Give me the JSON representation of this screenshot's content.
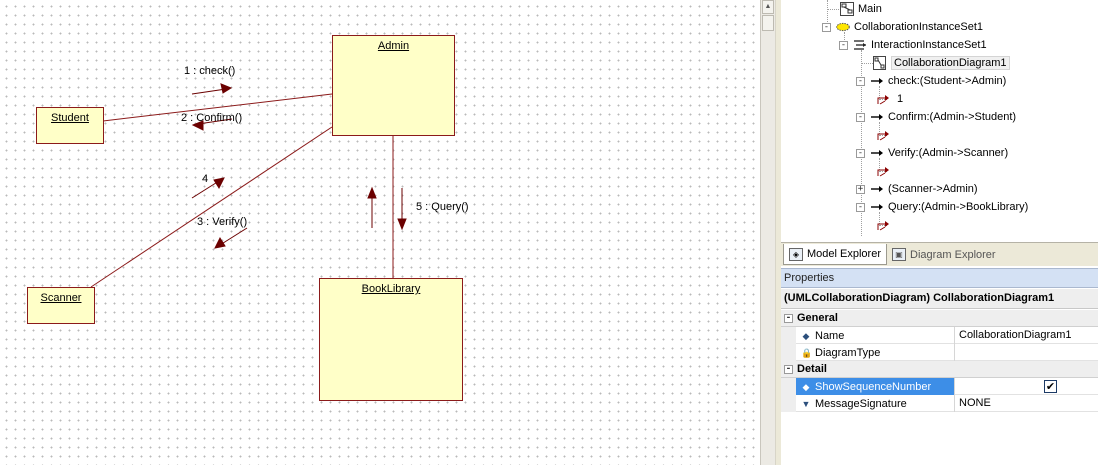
{
  "diagram": {
    "objects": {
      "admin": "Admin",
      "student": "Student",
      "scanner": "Scanner",
      "booklibrary": "BookLibrary"
    },
    "messages": {
      "m1": "1 : check()",
      "m2": "2 : Confirm()",
      "m3": "3 : Verify()",
      "m4": "4",
      "m5": "5 : Query()"
    },
    "colors": {
      "object_fill": "#ffffc8",
      "line": "#8b1a1a"
    }
  },
  "tree": {
    "rows": [
      {
        "label": "Main",
        "icon": "diagram-icon"
      },
      {
        "label": "CollaborationInstanceSet1",
        "icon": "collaboration-set-icon",
        "toggle": "⊟"
      },
      {
        "label": "InteractionInstanceSet1",
        "icon": "interaction-set-icon",
        "toggle": "⊟"
      },
      {
        "label": "CollaborationDiagram1",
        "icon": "collaboration-diagram-icon"
      },
      {
        "label": "check:(Student->Admin)",
        "icon": "message-arrow-icon",
        "toggle": "⊟"
      },
      {
        "label": "1",
        "icon": "stimulus-icon"
      },
      {
        "label": "Confirm:(Admin->Student)",
        "icon": "message-arrow-icon",
        "toggle": "⊟"
      },
      {
        "label": "",
        "icon": "stimulus-icon"
      },
      {
        "label": "Verify:(Admin->Scanner)",
        "icon": "message-arrow-icon",
        "toggle": "⊟"
      },
      {
        "label": "",
        "icon": "stimulus-icon"
      },
      {
        "label": "(Scanner->Admin)",
        "icon": "message-arrow-icon",
        "toggle": "⊞"
      },
      {
        "label": "Query:(Admin->BookLibrary)",
        "icon": "message-arrow-icon",
        "toggle": "⊟"
      },
      {
        "label": "",
        "icon": "stimulus-icon"
      }
    ]
  },
  "tabs": {
    "model_explorer": "Model Explorer",
    "diagram_explorer": "Diagram Explorer"
  },
  "properties": {
    "header": "Properties",
    "title": "(UMLCollaborationDiagram) CollaborationDiagram1",
    "sections": {
      "general": "General",
      "detail": "Detail"
    },
    "rows": {
      "name_key": "Name",
      "name_val": "CollaborationDiagram1",
      "diagramtype_key": "DiagramType",
      "diagramtype_val": "",
      "showseq_key": "ShowSequenceNumber",
      "showseq_val": "✔",
      "msgsig_key": "MessageSignature",
      "msgsig_val": "NONE"
    }
  }
}
